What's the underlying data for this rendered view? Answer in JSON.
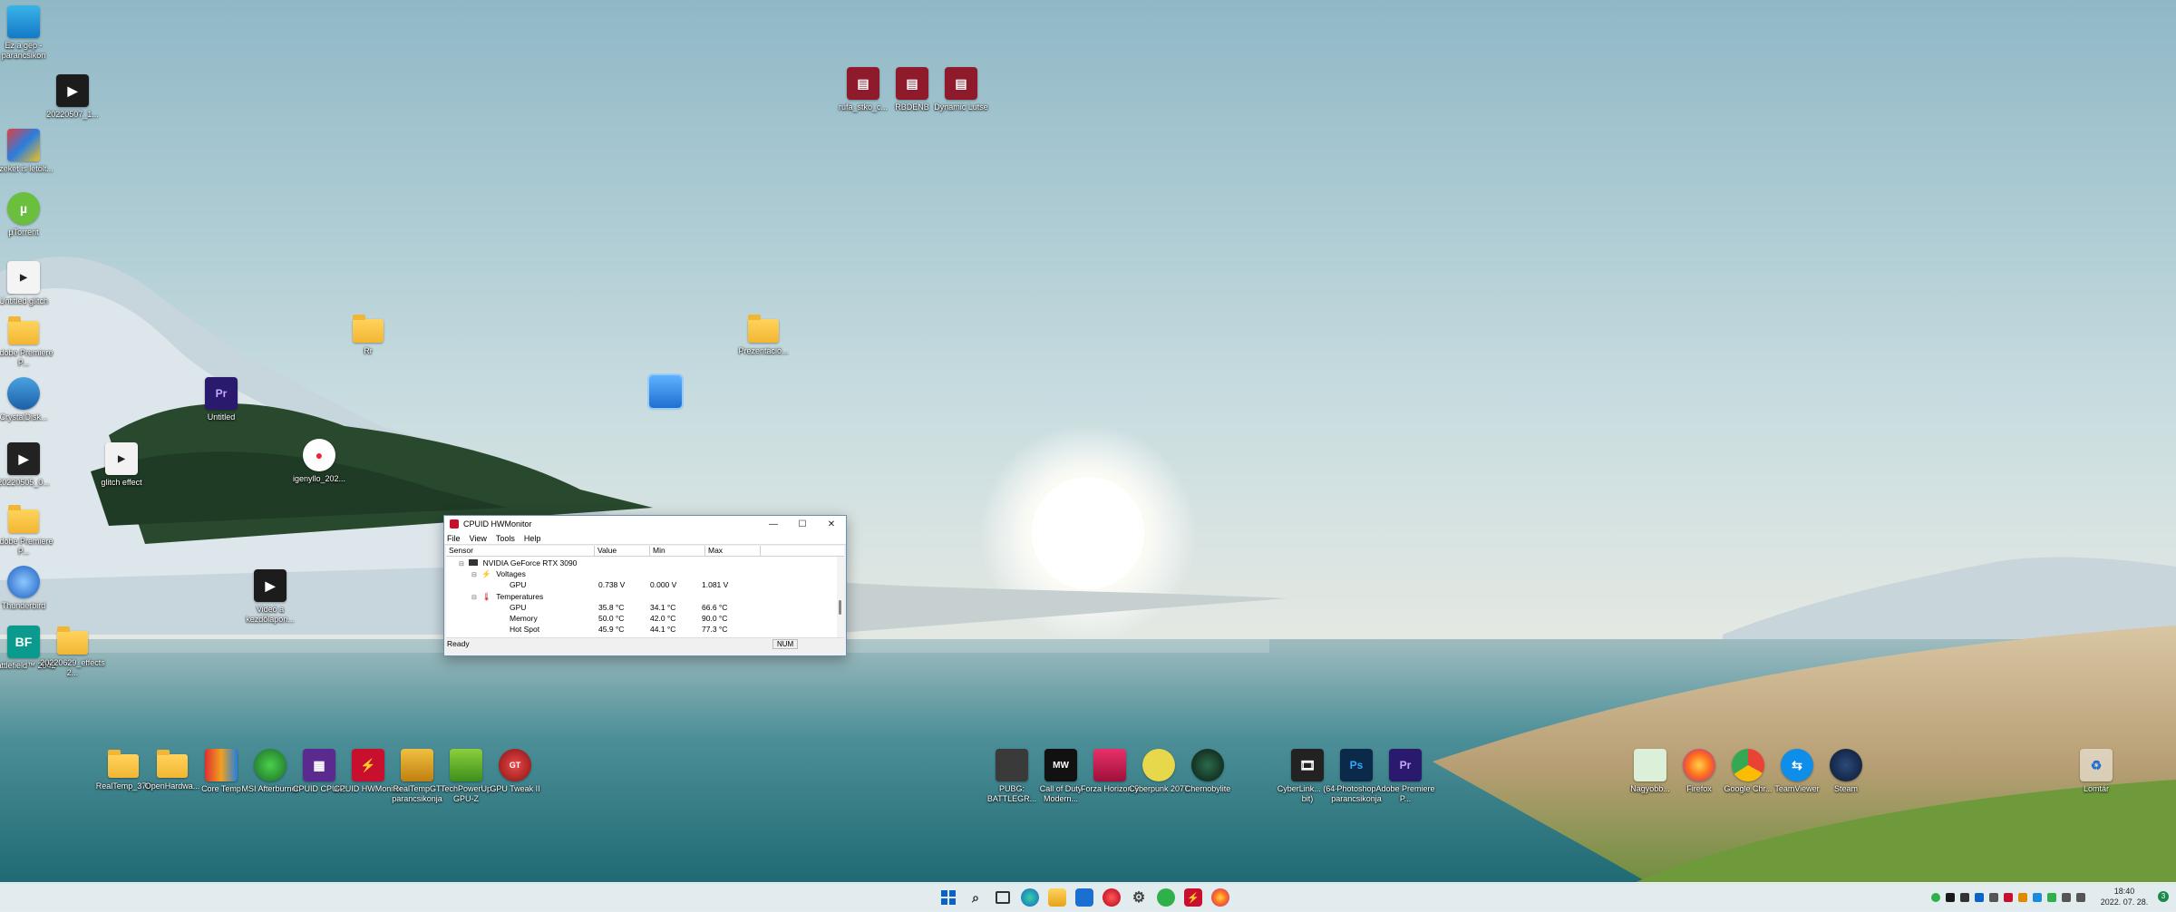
{
  "desktop": {
    "icons": {
      "monitor": {
        "label": "Ez a gép - parancsikon",
        "icon": "monitor-icon"
      },
      "video1": {
        "label": "20220507_1...",
        "icon": "video-file-icon"
      },
      "backdrop": {
        "label": "Ezeket is letölt...",
        "icon": "app-icon"
      },
      "utorrent": {
        "label": "µTorrent",
        "icon": "utorrent-icon"
      },
      "glitch1": {
        "label": "Untitled glitch",
        "icon": "video-file-icon"
      },
      "folder_left1": {
        "label": "Adobe Premiere P...",
        "icon": "folder-icon"
      },
      "crystaldisk": {
        "label": "CrystalDisk...",
        "icon": "crystaldisk-icon"
      },
      "video2": {
        "label": "20220505_0...",
        "icon": "video-file-icon"
      },
      "folder_adobe": {
        "label": "Adobe Premiere P...",
        "icon": "folder-icon"
      },
      "thunderbird": {
        "label": "Thunderbird",
        "icon": "thunderbird-icon"
      },
      "bf": {
        "label": "Battlefield™ 2042",
        "icon": "game-icon"
      },
      "folder_mid": {
        "label": "20220629_effects2...",
        "icon": "folder-icon"
      },
      "premiere_proj": {
        "label": "Untitled",
        "icon": "premiere-icon"
      },
      "glitcheffect": {
        "label": "glitch effect",
        "icon": "video-file-icon"
      },
      "ig": {
        "label": "igenyllo_202...",
        "icon": "app-icon"
      },
      "videoclip": {
        "label": "Videó a kezdőlapon...",
        "icon": "video-file-icon"
      },
      "folder_r": {
        "label": "Rr",
        "icon": "folder-icon"
      },
      "folder_p": {
        "label": "Prezentáció...",
        "icon": "folder-icon"
      },
      "winrar1": {
        "label": "rufa_stko_c...",
        "icon": "winrar-icon"
      },
      "winrar2": {
        "label": "RBDENB",
        "icon": "winrar-icon"
      },
      "winrar3": {
        "label": "Dynamic Lutse",
        "icon": "winrar-icon"
      },
      "mid_app": {
        "label": "",
        "icon": "app-icon"
      }
    },
    "bottom_left": [
      {
        "label": "RealTemp_370",
        "icon": "folder-icon"
      },
      {
        "label": "OpenHardwa...",
        "icon": "folder-icon"
      },
      {
        "label": "Core Temp",
        "icon": "coretemp-icon"
      },
      {
        "label": "MSI Afterburner",
        "icon": "afterburner-icon"
      },
      {
        "label": "CPUID CPU-Z",
        "icon": "cpuz-icon"
      },
      {
        "label": "CPUID HWMonitor",
        "icon": "hwmonitor-icon"
      },
      {
        "label": "RealTempGT parancsikonja",
        "icon": "realtemp-icon"
      },
      {
        "label": "TechPowerUp GPU-Z",
        "icon": "gpuz-icon"
      },
      {
        "label": "GPU Tweak II",
        "icon": "gputweak-icon"
      }
    ],
    "bottom_mid": [
      {
        "label": "PUBG: BATTLEGR...",
        "icon": "pubg-icon"
      },
      {
        "label": "Call of Duty Modern...",
        "icon": "cod-icon"
      },
      {
        "label": "Forza Horizon 5",
        "icon": "forza-icon"
      },
      {
        "label": "Cyberpunk 2077",
        "icon": "cyberpunk-icon"
      },
      {
        "label": "Chernobylite",
        "icon": "chernobylite-icon"
      }
    ],
    "bottom_mid2": [
      {
        "label": "CyberLink... (64-bit)",
        "icon": "video-app-icon"
      },
      {
        "label": "Photoshop parancsikonja",
        "icon": "photoshop-icon"
      },
      {
        "label": "Adobe Premiere P...",
        "icon": "premiere-icon"
      }
    ],
    "bottom_right": [
      {
        "label": "Nagyobb...",
        "icon": "app-icon"
      },
      {
        "label": "Firefox",
        "icon": "firefox-icon"
      },
      {
        "label": "Google Chr...",
        "icon": "chrome-icon"
      },
      {
        "label": "TeamViewer",
        "icon": "teamviewer-icon"
      },
      {
        "label": "Steam",
        "icon": "steam-icon"
      }
    ],
    "recycle": {
      "label": "Lomtár",
      "icon": "recycle-bin-icon"
    }
  },
  "hwmonitor": {
    "title": "CPUID HWMonitor",
    "menu": [
      "File",
      "View",
      "Tools",
      "Help"
    ],
    "columns": [
      "Sensor",
      "Value",
      "Min",
      "Max"
    ],
    "device": "NVIDIA GeForce RTX 3090",
    "groups": {
      "voltages": {
        "name": "Voltages",
        "rows": [
          {
            "sensor": "GPU",
            "value": "0.738 V",
            "min": "0.000 V",
            "max": "1.081 V"
          }
        ]
      },
      "temperatures": {
        "name": "Temperatures",
        "rows": [
          {
            "sensor": "GPU",
            "value": "35.8 °C",
            "min": "34.1 °C",
            "max": "66.6 °C"
          },
          {
            "sensor": "Memory",
            "value": "50.0 °C",
            "min": "42.0 °C",
            "max": "90.0 °C"
          },
          {
            "sensor": "Hot Spot",
            "value": "45.9 °C",
            "min": "44.1 °C",
            "max": "77.3 °C"
          }
        ]
      }
    },
    "status": "Ready",
    "numlock": "NUM"
  },
  "taskbar": {
    "time": "18:40",
    "date": "2022. 07. 28.",
    "notification_count": "3",
    "apps": [
      "start-icon",
      "search-icon",
      "task-view-icon",
      "edge-icon",
      "file-explorer-icon",
      "store-icon",
      "opera-icon",
      "settings-icon",
      "app-icon",
      "hwmonitor-icon",
      "firefox-icon"
    ]
  },
  "colors": {
    "accent": "#0a64c8",
    "winrar": "#8e1a2b",
    "premiere": "#2a1a6e"
  }
}
